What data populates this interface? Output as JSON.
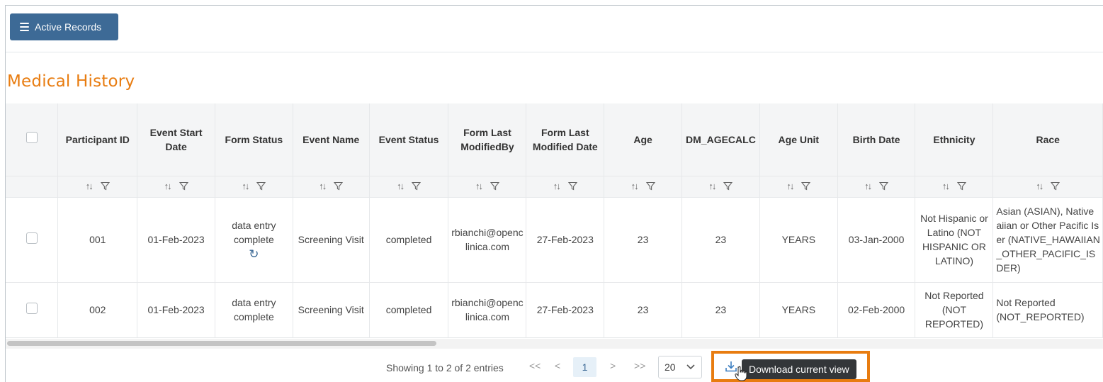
{
  "toolbar": {
    "active_records_label": "Active Records"
  },
  "page": {
    "title": "Medical History"
  },
  "table": {
    "headers": {
      "participant_id": "Participant ID",
      "event_start_date": "Event Start Date",
      "form_status": "Form Status",
      "event_name": "Event Name",
      "event_status": "Event Status",
      "form_last_modified_by": "Form Last ModifiedBy",
      "form_last_modified_date": "Form Last Modified Date",
      "age": "Age",
      "dm_agecalc": "DM_AGECALC",
      "age_unit": "Age Unit",
      "birth_date": "Birth Date",
      "ethnicity": "Ethnicity",
      "race": "Race"
    },
    "rows": [
      {
        "participant_id": "001",
        "event_start_date": "01-Feb-2023",
        "form_status": "data entry complete",
        "event_name": "Screening Visit",
        "event_status": "completed",
        "form_last_modified_by": "rbianchi@openclinica.com",
        "form_last_modified_date": "27-Feb-2023",
        "age": "23",
        "dm_agecalc": "23",
        "age_unit": "YEARS",
        "birth_date": "03-Jan-2000",
        "ethnicity": "Not Hispanic or Latino (NOT HISPANIC OR LATINO)",
        "race_lines": [
          "Asian (ASIAN), Native",
          "aiian or Other Pacific Is",
          "er (NATIVE_HAWAIIAN",
          "_OTHER_PACIFIC_IS",
          "DER)"
        ]
      },
      {
        "participant_id": "002",
        "event_start_date": "01-Feb-2023",
        "form_status": "data entry complete",
        "event_name": "Screening Visit",
        "event_status": "completed",
        "form_last_modified_by": "rbianchi@openclinica.com",
        "form_last_modified_date": "27-Feb-2023",
        "age": "23",
        "dm_agecalc": "23",
        "age_unit": "YEARS",
        "birth_date": "02-Feb-2000",
        "ethnicity": "Not Reported (NOT REPORTED)",
        "race_lines": [
          "Not Reported",
          "(NOT_REPORTED)"
        ]
      }
    ]
  },
  "pagination": {
    "info": "Showing 1 to 2 of 2 entries",
    "first": "<<",
    "prev": "<",
    "current_page": "1",
    "next": ">",
    "last": ">>",
    "page_size": "20"
  },
  "download": {
    "tooltip": "Download current view"
  },
  "colors": {
    "brand_orange": "#e87c10",
    "button_blue": "#3d6a96"
  },
  "icons": [
    "hamburger-icon",
    "sort-icon",
    "filter-icon",
    "reopen-icon",
    "download-icon",
    "chevron-down-icon",
    "hand-cursor-icon"
  ]
}
